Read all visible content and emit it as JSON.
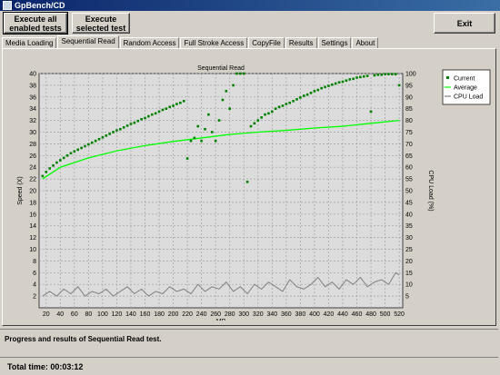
{
  "window": {
    "title": "GpBench/CD"
  },
  "toolbar": {
    "execute_all_label": "Execute all enabled tests",
    "execute_selected_label": "Execute selected test",
    "exit_label": "Exit"
  },
  "tabs": [
    {
      "label": "Media Loading"
    },
    {
      "label": "Sequential Read"
    },
    {
      "label": "Random Access"
    },
    {
      "label": "Full Stroke Access"
    },
    {
      "label": "CopyFile"
    },
    {
      "label": "Results"
    },
    {
      "label": "Settings"
    },
    {
      "label": "About"
    }
  ],
  "active_tab": "Sequential Read",
  "status": {
    "text": "Progress and results of Sequential Read test."
  },
  "footer": {
    "total_time": "Total time:  00:03:12"
  },
  "colors": {
    "current": "#008000",
    "average": "#00ff00",
    "cpu": "#808080",
    "plot_bg": "#dcdcdc",
    "grid": "#a0a0a0"
  },
  "chart_data": {
    "type": "line",
    "title": "Sequential Read",
    "xlabel": "MB",
    "ylabel_left": "Speed (X)",
    "ylabel_right": "CPU Load (%)",
    "xlim": [
      10,
      525
    ],
    "ylim_left": [
      0,
      40
    ],
    "ylim_right": [
      0,
      100
    ],
    "x_ticks": [
      20,
      40,
      60,
      80,
      100,
      120,
      140,
      160,
      180,
      200,
      220,
      240,
      260,
      280,
      300,
      320,
      340,
      360,
      380,
      400,
      420,
      440,
      460,
      480,
      500,
      520
    ],
    "y_ticks_left": [
      2,
      4,
      6,
      8,
      10,
      12,
      14,
      16,
      18,
      20,
      22,
      24,
      26,
      28,
      30,
      32,
      34,
      36,
      38,
      40
    ],
    "y_ticks_right": [
      5,
      10,
      15,
      20,
      25,
      30,
      35,
      40,
      45,
      50,
      55,
      60,
      65,
      70,
      75,
      80,
      85,
      90,
      95,
      100
    ],
    "grid": true,
    "legend_position": "top-right",
    "series": [
      {
        "name": "Current",
        "style": "scatter",
        "x": [
          15,
          20,
          25,
          30,
          35,
          40,
          45,
          50,
          55,
          60,
          65,
          70,
          75,
          80,
          85,
          90,
          95,
          100,
          105,
          110,
          115,
          120,
          125,
          130,
          135,
          140,
          145,
          150,
          155,
          160,
          165,
          170,
          175,
          180,
          185,
          190,
          195,
          200,
          205,
          210,
          215,
          220,
          225,
          230,
          235,
          240,
          245,
          250,
          255,
          260,
          265,
          270,
          275,
          280,
          285,
          290,
          295,
          300,
          305,
          310,
          315,
          320,
          325,
          330,
          335,
          340,
          345,
          350,
          355,
          360,
          365,
          370,
          375,
          380,
          385,
          390,
          395,
          400,
          405,
          410,
          415,
          420,
          425,
          430,
          435,
          440,
          445,
          450,
          455,
          460,
          465,
          470,
          475,
          480,
          485,
          490,
          495,
          500,
          505,
          510,
          515,
          520
        ],
        "y": [
          22.5,
          23.2,
          23.8,
          24.3,
          24.8,
          25.2,
          25.6,
          26.0,
          26.4,
          26.7,
          27.0,
          27.3,
          27.6,
          27.9,
          28.2,
          28.5,
          28.8,
          29.1,
          29.4,
          29.7,
          30.0,
          30.3,
          30.5,
          30.8,
          31.1,
          31.4,
          31.6,
          31.9,
          32.2,
          32.4,
          32.7,
          33.0,
          33.2,
          33.5,
          33.8,
          34.0,
          34.3,
          34.5,
          34.8,
          35.0,
          35.3,
          25.5,
          28.5,
          29.0,
          31.0,
          28.5,
          30.5,
          33.0,
          30.0,
          28.5,
          32.0,
          35.5,
          37.0,
          34.0,
          38.0,
          40.0,
          40.0,
          40.0,
          21.5,
          31.0,
          31.5,
          32.0,
          32.5,
          33.0,
          33.2,
          33.5,
          34.0,
          34.3,
          34.5,
          34.8,
          35.0,
          35.3,
          35.6,
          35.9,
          36.2,
          36.4,
          36.7,
          37.0,
          37.2,
          37.5,
          37.7,
          37.9,
          38.1,
          38.3,
          38.5,
          38.6,
          38.8,
          39.0,
          39.1,
          39.3,
          39.4,
          39.5,
          39.6,
          33.5,
          39.7,
          39.8,
          39.8,
          39.9,
          39.9,
          39.9,
          39.9,
          38.0
        ]
      },
      {
        "name": "Average",
        "style": "line",
        "x": [
          15,
          40,
          80,
          120,
          160,
          200,
          240,
          280,
          320,
          360,
          400,
          440,
          480,
          520
        ],
        "y": [
          22.0,
          24.0,
          25.6,
          26.8,
          27.7,
          28.4,
          29.0,
          29.6,
          30.0,
          30.3,
          30.7,
          31.0,
          31.5,
          32.0
        ]
      },
      {
        "name": "CPU Load",
        "style": "line",
        "axis": "right",
        "x": [
          15,
          25,
          35,
          45,
          55,
          65,
          75,
          85,
          95,
          105,
          115,
          125,
          135,
          145,
          155,
          165,
          175,
          185,
          195,
          205,
          215,
          225,
          235,
          245,
          255,
          265,
          275,
          285,
          295,
          305,
          315,
          325,
          335,
          345,
          355,
          365,
          375,
          385,
          395,
          405,
          415,
          425,
          435,
          445,
          455,
          465,
          475,
          485,
          495,
          505,
          515,
          520
        ],
        "y": [
          5,
          7,
          5,
          8,
          6,
          9,
          5,
          7,
          6,
          8,
          5,
          7,
          9,
          6,
          8,
          5,
          7,
          6,
          9,
          7,
          8,
          6,
          10,
          7,
          9,
          8,
          11,
          7,
          9,
          6,
          10,
          8,
          11,
          9,
          7,
          12,
          9,
          8,
          10,
          13,
          9,
          11,
          8,
          12,
          10,
          13,
          9,
          11,
          12,
          10,
          15,
          14
        ]
      }
    ]
  }
}
